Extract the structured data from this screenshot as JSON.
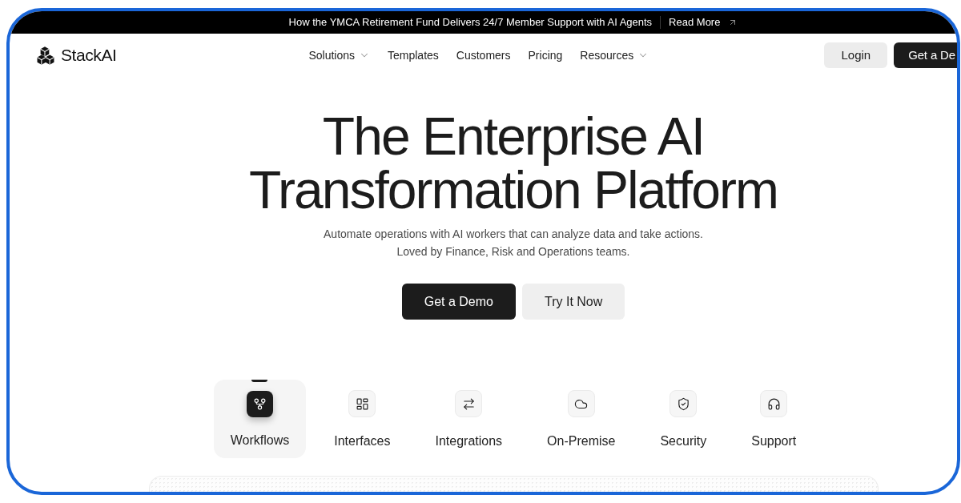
{
  "announcement": {
    "text": "How the YMCA Retirement Fund Delivers 24/7 Member Support with AI Agents",
    "link": "Read More"
  },
  "navbar": {
    "brand": "StackAI",
    "links": [
      {
        "label": "Solutions",
        "dropdown": true
      },
      {
        "label": "Templates",
        "dropdown": false
      },
      {
        "label": "Customers",
        "dropdown": false
      },
      {
        "label": "Pricing",
        "dropdown": false
      },
      {
        "label": "Resources",
        "dropdown": true
      }
    ],
    "login": "Login",
    "cta": "Get a De"
  },
  "hero": {
    "title": [
      "The Enterprise AI",
      "Transformation Platform"
    ],
    "subtitle": [
      "Automate operations with AI workers that can analyze data and take actions.",
      "Loved by Finance, Risk and Operations teams."
    ],
    "buttons": [
      {
        "label": "Get a Demo",
        "kind": "primary"
      },
      {
        "label": "Try It Now",
        "kind": "secondary"
      }
    ]
  },
  "features": [
    {
      "label": "Workflows",
      "selected": true
    },
    {
      "label": "Interfaces",
      "selected": false
    },
    {
      "label": "Integrations",
      "selected": false
    },
    {
      "label": "On-Premise",
      "selected": false
    },
    {
      "label": "Security",
      "selected": false
    },
    {
      "label": "Support",
      "selected": false
    }
  ]
}
